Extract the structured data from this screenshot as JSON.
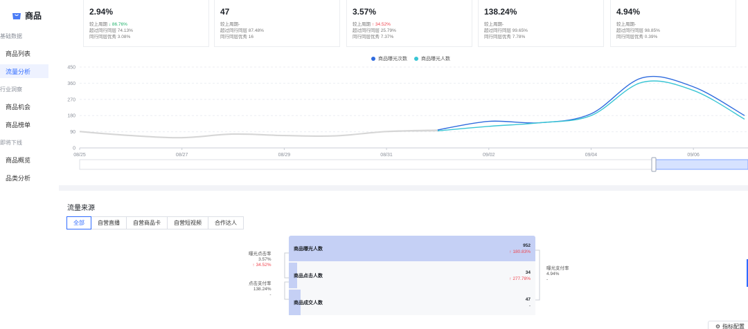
{
  "sidebar": {
    "header": {
      "icon": "shopping-bag-icon",
      "title": "商品"
    },
    "groups": [
      "基础数据",
      "行业洞察",
      "即将下线"
    ],
    "items": [
      "商品列表",
      "流量分析",
      "商品机会",
      "商品榜单",
      "商品概览",
      "品类分析"
    ]
  },
  "kpis": [
    {
      "value": "2.94%",
      "l1_prefix": "较上周期",
      "l1_arrow": "↓",
      "l1_delta": "86.76%",
      "l1_dir": "down",
      "l2": "超过同行同层 74.13%",
      "l3": "同行同层优秀 3.08%"
    },
    {
      "value": "47",
      "l1_prefix": "较上周期-",
      "l1_arrow": "",
      "l1_delta": "",
      "l1_dir": "none",
      "l2": "超过同行同层 87.48%",
      "l3": "同行同层优秀 16"
    },
    {
      "value": "3.57%",
      "l1_prefix": "较上周期",
      "l1_arrow": "↑",
      "l1_delta": "34.52%",
      "l1_dir": "up",
      "l2": "超过同行同层 25.79%",
      "l3": "同行同层优秀 7.37%"
    },
    {
      "value": "138.24%",
      "l1_prefix": "较上周期-",
      "l1_arrow": "",
      "l1_delta": "",
      "l1_dir": "none",
      "l2": "超过同行同层 99.65%",
      "l3": "同行同层优秀 7.78%"
    },
    {
      "value": "4.94%",
      "l1_prefix": "较上周期-",
      "l1_arrow": "",
      "l1_delta": "",
      "l1_dir": "none",
      "l2": "超过同行同层 98.85%",
      "l3": "同行同层优秀 0.39%"
    }
  ],
  "chart_data": {
    "type": "line",
    "x": [
      "08/25",
      "08/26",
      "08/27",
      "08/28",
      "08/29",
      "08/30",
      "08/31",
      "09/01",
      "09/02",
      "09/03",
      "09/04",
      "09/05",
      "09/06",
      "09/07"
    ],
    "x_tick_labels": [
      "08/25",
      "08/27",
      "08/29",
      "08/31",
      "09/02",
      "09/04",
      "09/06"
    ],
    "y_ticks": [
      0,
      90,
      180,
      270,
      360,
      450
    ],
    "ylim": [
      0,
      450
    ],
    "series": [
      {
        "name": "商品曝光次数",
        "color": "#2f6bde",
        "values": [
          92,
          70,
          58,
          78,
          70,
          68,
          92,
          100,
          148,
          140,
          190,
          390,
          340,
          180
        ]
      },
      {
        "name": "商品曝光人数",
        "color": "#39c5d4",
        "values": [
          90,
          68,
          56,
          76,
          68,
          66,
          90,
          95,
          120,
          140,
          180,
          365,
          320,
          160
        ]
      }
    ],
    "comparison_color": "#d6d6d6",
    "split_index": 7,
    "legend": "top"
  },
  "traffic": {
    "title": "流量来源",
    "tabs": [
      "全部",
      "自营直播",
      "自营商品卡",
      "自营短视频",
      "合作达人"
    ],
    "funnel": [
      {
        "name": "商品曝光人数",
        "value": "952",
        "arrow": "↑",
        "delta": "180.83%",
        "dir": "up"
      },
      {
        "name": "商品点击人数",
        "value": "34",
        "arrow": "↑",
        "delta": "277.78%",
        "dir": "up"
      },
      {
        "name": "商品成交人数",
        "value": "47",
        "arrow": "",
        "delta": "-",
        "dir": "none"
      }
    ],
    "ctr": {
      "label": "曝光点击率",
      "value": "3.57%",
      "arrow": "↑",
      "delta": "34.52%"
    },
    "click_pay": {
      "label": "点击支付率",
      "value": "138.24%",
      "delta": "-"
    },
    "exposure_pay": {
      "label": "曝光支付率",
      "value": "4.94%",
      "delta": "-"
    },
    "config_button": "指标配置"
  }
}
